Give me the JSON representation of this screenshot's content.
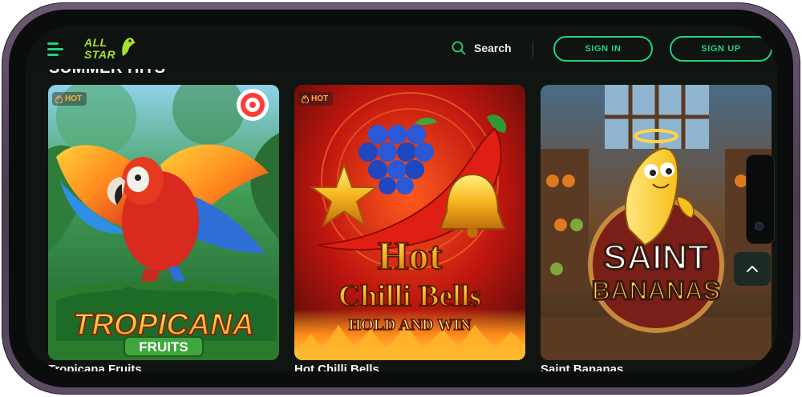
{
  "brand": {
    "logo_line1": "ALL",
    "logo_line2": "STAR",
    "accent": "#26d07c",
    "logo_color": "#a6e22b"
  },
  "header": {
    "search_label": "Search",
    "sign_in": "SIGN IN",
    "sign_up": "SIGN UP"
  },
  "section": {
    "title": "SUMMER HITS"
  },
  "games": [
    {
      "title": "Tropicana Fruits",
      "badge": "HOT",
      "art_line1": "TROPICANA",
      "art_line2": "FRUITS"
    },
    {
      "title": "Hot Chilli Bells",
      "badge": "HOT",
      "art_line1": "Hot",
      "art_line2": "Chilli Bells",
      "art_line3": "HOLD AND WIN"
    },
    {
      "title": "Saint Bananas",
      "art_line1": "SAINT",
      "art_line2": "BANANAS"
    }
  ],
  "icons": {
    "menu": "hamburger-icon",
    "search": "search-icon",
    "scroll": "chevron-up-icon",
    "hot": "flame-icon"
  }
}
